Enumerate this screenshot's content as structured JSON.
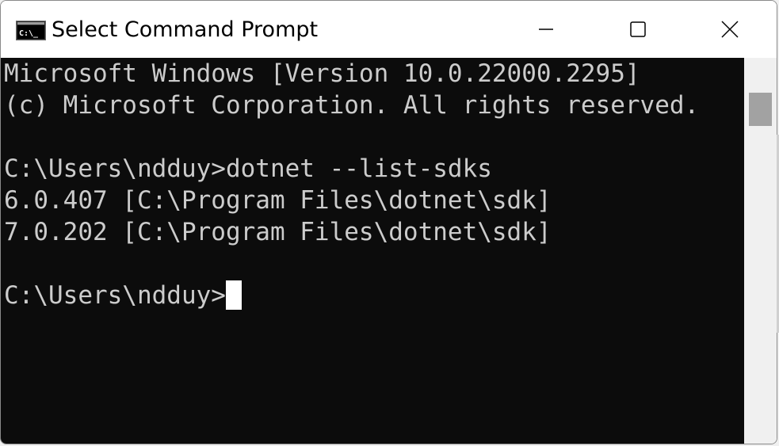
{
  "window": {
    "title": "Select Command Prompt",
    "icon": "console-icon",
    "controls": {
      "minimize": "minimize-icon",
      "maximize": "maximize-icon",
      "close": "close-icon"
    }
  },
  "console": {
    "lines": [
      "Microsoft Windows [Version 10.0.22000.2295]",
      "(c) Microsoft Corporation. All rights reserved.",
      "",
      "C:\\Users\\ndduy>dotnet --list-sdks",
      "6.0.407 [C:\\Program Files\\dotnet\\sdk]",
      "7.0.202 [C:\\Program Files\\dotnet\\sdk]",
      "",
      "C:\\Users\\ndduy>"
    ],
    "colors": {
      "background": "#0c0c0c",
      "foreground": "#cccccc",
      "cursor": "#ffffff"
    }
  }
}
